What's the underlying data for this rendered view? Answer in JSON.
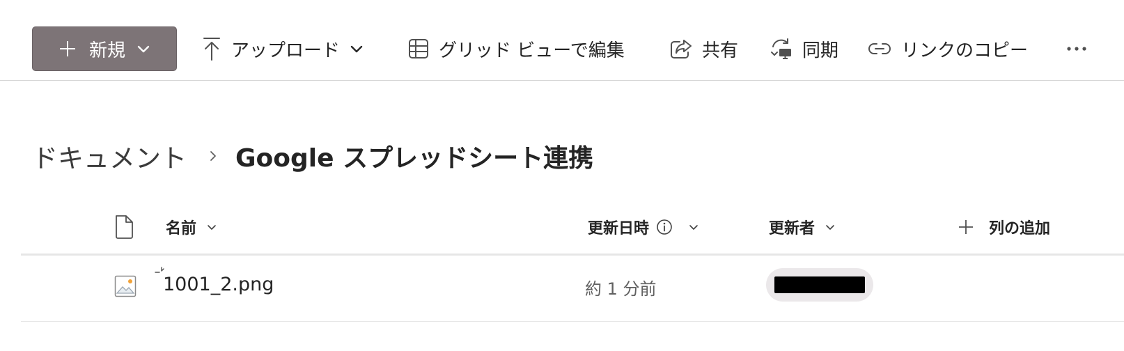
{
  "toolbar": {
    "new_label": "新規",
    "upload_label": "アップロード",
    "grid_label": "グリッド ビューで編集",
    "share_label": "共有",
    "sync_label": "同期",
    "copy_link_label": "リンクのコピー"
  },
  "breadcrumb": {
    "root": "ドキュメント",
    "current": "Google スプレッドシート連携"
  },
  "columns": {
    "name": "名前",
    "modified": "更新日時",
    "modified_by": "更新者",
    "add_column": "列の追加"
  },
  "files": [
    {
      "name": "1001_2.png",
      "modified": "約 1 分前",
      "modified_by": ""
    }
  ],
  "colors": {
    "new_button": "#7d7477",
    "divider": "#e6e6e6",
    "persona_bg": "#ebe8ea"
  }
}
